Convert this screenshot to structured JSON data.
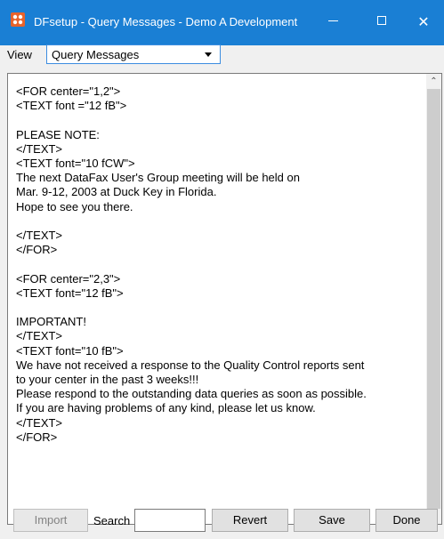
{
  "window": {
    "title": "DFsetup - Query Messages - Demo A Development",
    "app_icon": "app-logo-icon",
    "controls": {
      "minimize": "minimize-icon",
      "maximize": "maximize-icon",
      "close": "close-icon",
      "close_glyph": "✕"
    }
  },
  "view": {
    "label": "View",
    "selected": "Query Messages"
  },
  "editor": {
    "content": "<FOR center=\"1,2\">\n<TEXT font =\"12 fB\">\n\nPLEASE NOTE:\n</TEXT>\n<TEXT font=\"10 fCW\">\nThe next DataFax User's Group meeting will be held on\nMar. 9-12, 2003 at Duck Key in Florida.\nHope to see you there.\n\n</TEXT>\n</FOR>\n\n<FOR center=\"2,3\">\n<TEXT font=\"12 fB\">\n\nIMPORTANT!\n</TEXT>\n<TEXT font=\"10 fB\">\nWe have not received a response to the Quality Control reports sent\nto your center in the past 3 weeks!!!\nPlease respond to the outstanding data queries as soon as possible.\nIf you are having problems of any kind, please let us know.\n</TEXT>\n</FOR>",
    "scroll_up_glyph": "⌃",
    "scroll_down_glyph": "⌄"
  },
  "footer": {
    "import_label": "Import",
    "search_label": "Search",
    "search_value": "",
    "revert_label": "Revert",
    "save_label": "Save",
    "done_label": "Done"
  },
  "colors": {
    "titlebar": "#1a7fd4",
    "select_border": "#3c8de0",
    "app_icon_orange": "#e8632b"
  }
}
